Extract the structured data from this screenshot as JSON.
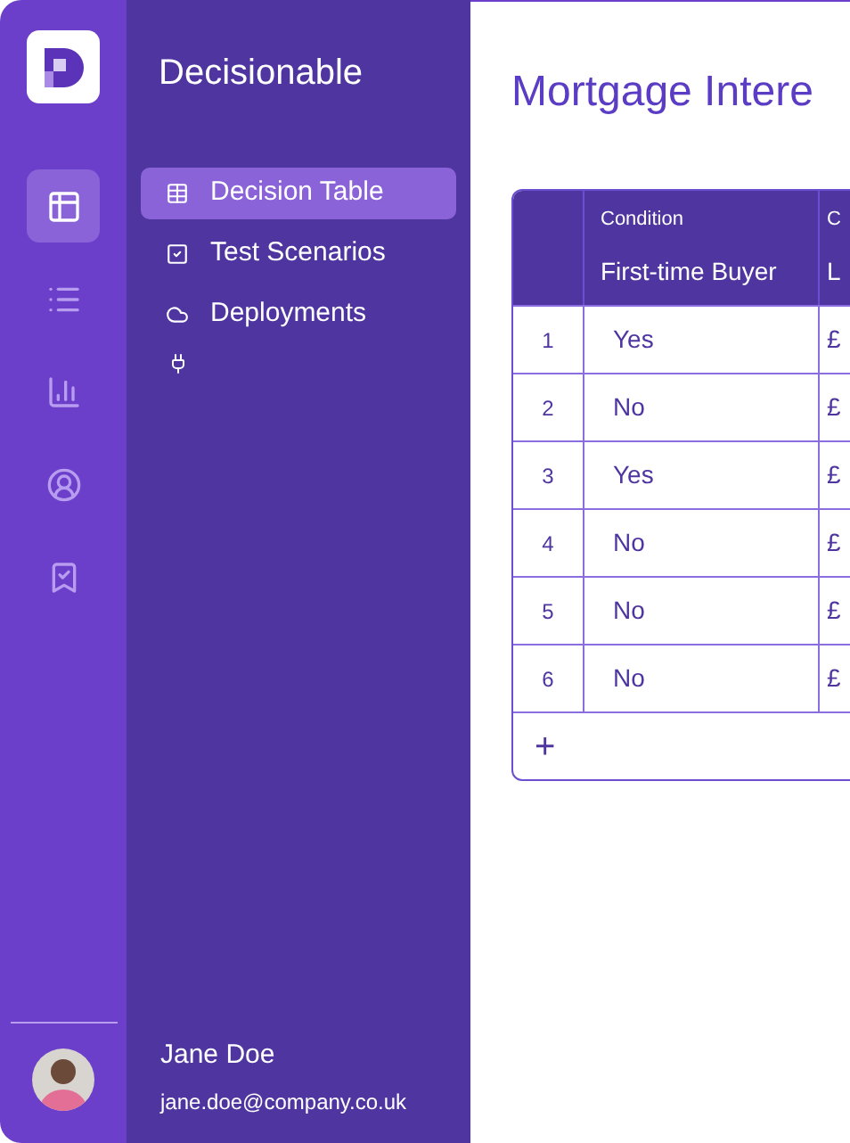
{
  "rail": {
    "items": [
      {
        "selected": true
      },
      {
        "selected": false
      },
      {
        "selected": false
      },
      {
        "selected": false
      },
      {
        "selected": false
      }
    ]
  },
  "sidebar": {
    "title": "Decisionable",
    "items": [
      {
        "label": "Decision Table",
        "selected": true
      },
      {
        "label": "Test Scenarios",
        "selected": false
      },
      {
        "label": "Deployments",
        "selected": false
      },
      {
        "selected": false
      }
    ]
  },
  "user": {
    "name": "Jane Doe",
    "email": "jane.doe@company.co.uk"
  },
  "page": {
    "title": "Mortgage Intere"
  },
  "table": {
    "columns": [
      {
        "kind": "Condition",
        "name": "First-time Buyer"
      },
      {
        "kind": "C",
        "name": "L"
      }
    ],
    "rows": [
      {
        "number": "1",
        "cells": [
          "Yes",
          "£"
        ]
      },
      {
        "number": "2",
        "cells": [
          "No",
          "£"
        ]
      },
      {
        "number": "3",
        "cells": [
          "Yes",
          "£"
        ]
      },
      {
        "number": "4",
        "cells": [
          "No",
          "£"
        ]
      },
      {
        "number": "5",
        "cells": [
          "No",
          "£"
        ]
      },
      {
        "number": "6",
        "cells": [
          "No",
          "£"
        ]
      }
    ],
    "add_row": "+"
  }
}
